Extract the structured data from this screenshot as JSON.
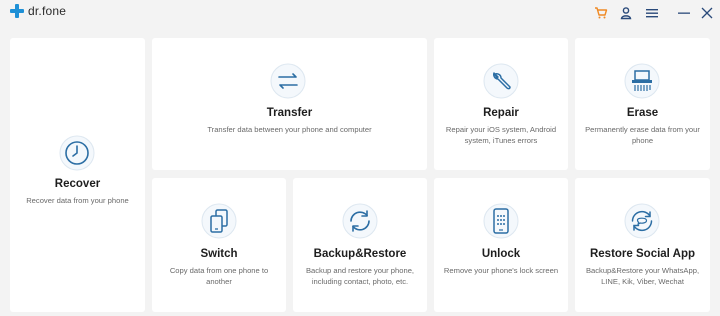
{
  "app": {
    "name": "dr.fone"
  },
  "colors": {
    "accent": "#1e90d6",
    "cart": "#f08a24",
    "icon": "#2c6ea4",
    "title": "#1e1e1e",
    "desc": "#6a6a6a"
  },
  "titlebar_icons": [
    "cart-icon",
    "user-icon",
    "menu-icon",
    "minimize-icon",
    "close-icon"
  ],
  "cards": {
    "recover": {
      "title": "Recover",
      "desc": "Recover data from your phone",
      "icon": "clock-icon"
    },
    "transfer": {
      "title": "Transfer",
      "desc": "Transfer data between your phone and computer",
      "icon": "transfer-arrows-icon"
    },
    "repair": {
      "title": "Repair",
      "desc": "Repair your iOS system, Android system, iTunes errors",
      "icon": "wrench-icon"
    },
    "erase": {
      "title": "Erase",
      "desc": "Permanently erase data from your phone",
      "icon": "shredder-icon"
    },
    "switch": {
      "title": "Switch",
      "desc": "Copy data from one phone to another",
      "icon": "phone-switch-icon"
    },
    "backup": {
      "title": "Backup&Restore",
      "desc": "Backup and restore your phone, including contact, photo, etc.",
      "icon": "sync-icon"
    },
    "unlock": {
      "title": "Unlock",
      "desc": "Remove your phone's lock screen",
      "icon": "phone-keypad-icon"
    },
    "social": {
      "title": "Restore Social App",
      "desc": "Backup&Restore your WhatsApp, LINE, Kik, Viber, Wechat",
      "icon": "social-restore-icon"
    }
  }
}
